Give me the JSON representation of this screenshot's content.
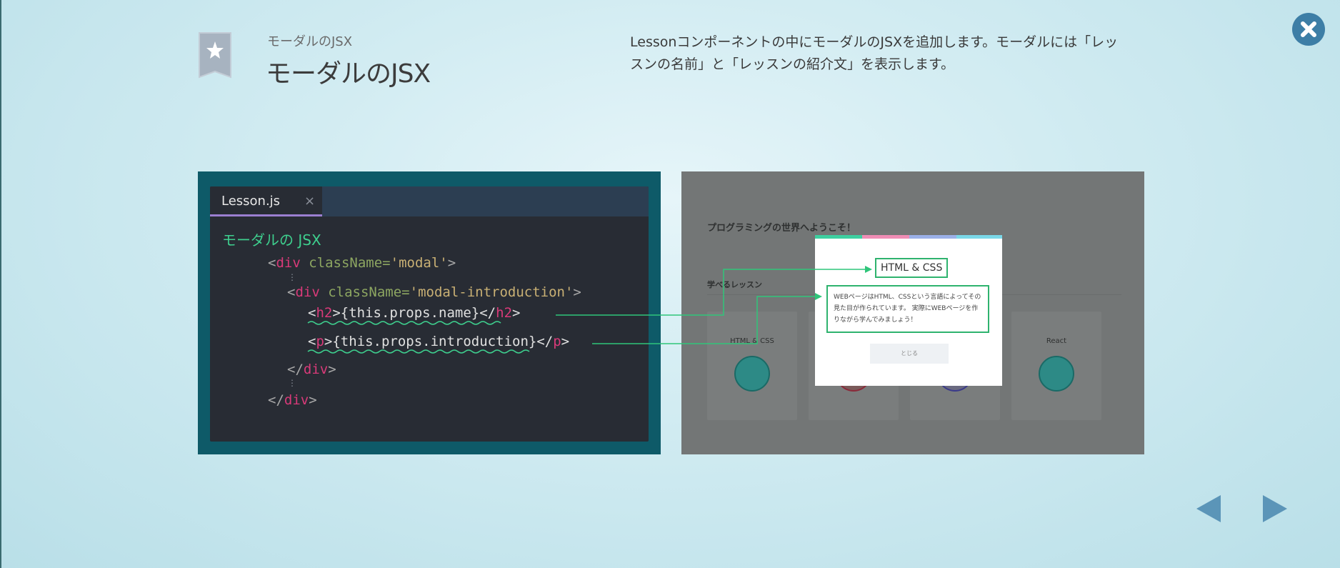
{
  "header": {
    "subtitle": "モーダルのJSX",
    "title": "モーダルのJSX",
    "description": "Lessonコンポーネントの中にモーダルのJSXを追加します。モーダルには「レッスンの名前」と「レッスンの紹介文」を表示します。"
  },
  "icons": {
    "close": "close-icon",
    "bookmark": "bookmark-star-icon",
    "prev": "prev-arrow-icon",
    "next": "next-arrow-icon"
  },
  "editor": {
    "tab_label": "Lesson.js",
    "tab_close": "×",
    "code_title": "モーダルの JSX",
    "lines": {
      "l1": {
        "open": "<",
        "tag": "div",
        "attr": " className=",
        "str": "'modal'",
        "close": ">"
      },
      "l2": {
        "open": "<",
        "tag": "div",
        "attr": " className=",
        "str": "'modal-introduction'",
        "close": ">"
      },
      "l3": {
        "open": "<",
        "tag": "h2",
        "mid": ">{this.props.name}</",
        "tag2": "h2",
        "close": ">"
      },
      "l4": {
        "open": "<",
        "tag": "p",
        "mid": ">{this.props.introduction}</",
        "tag2": "p",
        "close": ">"
      },
      "l5": {
        "open": "</",
        "tag": "div",
        "close": ">"
      },
      "l6": {
        "open": "</",
        "tag": "div",
        "close": ">"
      }
    },
    "dots": "⋮"
  },
  "preview": {
    "heading": "プログラミングの世界へようこそ！",
    "section": "学べるレッスン",
    "cards": [
      "HTML & CSS",
      "",
      "",
      "React"
    ],
    "modal": {
      "name": "HTML & CSS",
      "introduction": "WEBページはHTML、CSSという言語によってその見た目が作られています。 実際にWEBページを作りながら学んでみましょう！",
      "button": "とじる"
    }
  },
  "colors": {
    "accent_green": "#2fb36e",
    "code_bg": "#282c34",
    "panel_bg": "#0e5a68",
    "nav_arrow": "#5b95b8",
    "close_bg": "#3d7ea6"
  }
}
